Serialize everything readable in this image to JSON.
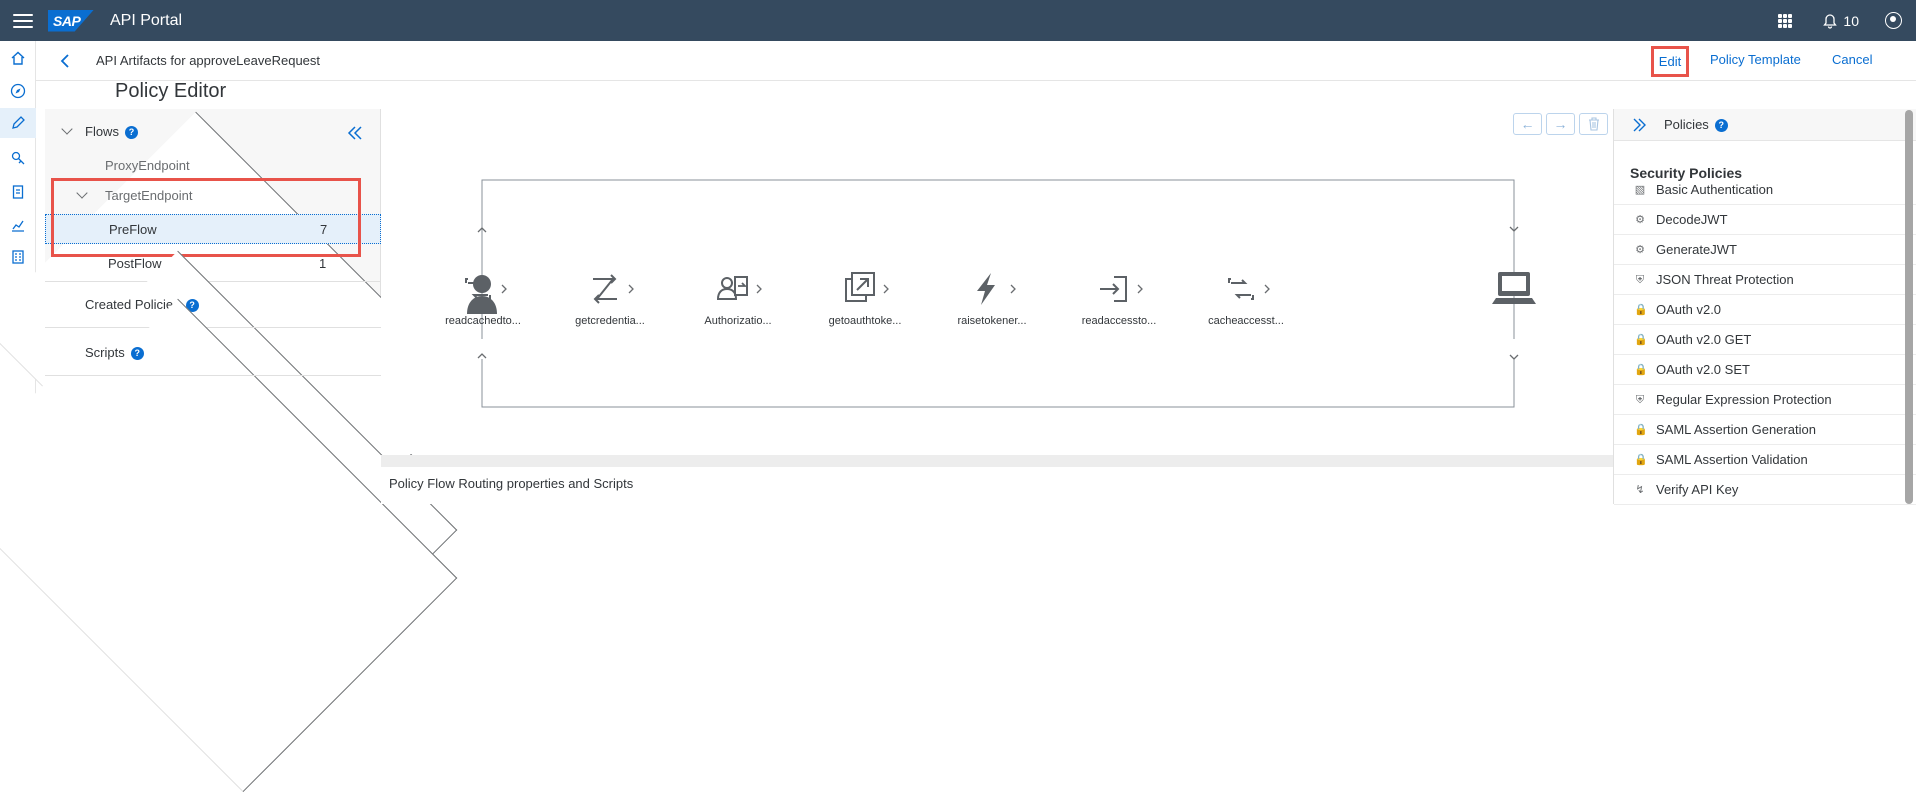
{
  "shell": {
    "app_title": "API Portal",
    "logo": "SAP",
    "notification_count": "10"
  },
  "header": {
    "breadcrumb": "API Artifacts for approveLeaveRequest",
    "edit_label": "Edit",
    "policy_template_label": "Policy Template",
    "cancel_label": "Cancel"
  },
  "page": {
    "title": "Policy Editor"
  },
  "flows": {
    "label": "Flows",
    "proxy_endpoint": "ProxyEndpoint",
    "target_endpoint": "TargetEndpoint",
    "preflow": {
      "label": "PreFlow",
      "count": "7"
    },
    "postflow": {
      "label": "PostFlow",
      "count": "1"
    },
    "created_policies": "Created Policies",
    "scripts": "Scripts"
  },
  "flow_policies": [
    {
      "label": "readcachedto...",
      "icon": "cache-refresh-icon"
    },
    {
      "label": "getcredentia...",
      "icon": "extract-variables-icon"
    },
    {
      "label": "Authorizatio...",
      "icon": "authorization-icon"
    },
    {
      "label": "getoauthtoke...",
      "icon": "service-callout-icon"
    },
    {
      "label": "raisetokener...",
      "icon": "raise-fault-icon"
    },
    {
      "label": "readaccessto...",
      "icon": "key-value-import-icon"
    },
    {
      "label": "cacheaccesst...",
      "icon": "cache-refresh-icon"
    }
  ],
  "props": {
    "label": "Policy Flow Routing properties and Scripts"
  },
  "policies_panel": {
    "title": "Policies",
    "section": "Security Policies",
    "items": [
      {
        "label": "Basic Authentication",
        "icon": "basic-auth-icon"
      },
      {
        "label": "DecodeJWT",
        "icon": "gear-icon"
      },
      {
        "label": "GenerateJWT",
        "icon": "gear-icon"
      },
      {
        "label": "JSON Threat Protection",
        "icon": "shield-icon"
      },
      {
        "label": "OAuth v2.0",
        "icon": "lock-icon"
      },
      {
        "label": "OAuth v2.0 GET",
        "icon": "lock-icon"
      },
      {
        "label": "OAuth v2.0 SET",
        "icon": "lock-icon"
      },
      {
        "label": "Regular Expression Protection",
        "icon": "shield-icon"
      },
      {
        "label": "SAML Assertion Generation",
        "icon": "lock-icon"
      },
      {
        "label": "SAML Assertion Validation",
        "icon": "lock-icon"
      },
      {
        "label": "Verify API Key",
        "icon": "key-icon"
      }
    ]
  },
  "colors": {
    "shell": "#354a5f",
    "accent": "#0a6ed1",
    "highlight": "#e8534a"
  }
}
